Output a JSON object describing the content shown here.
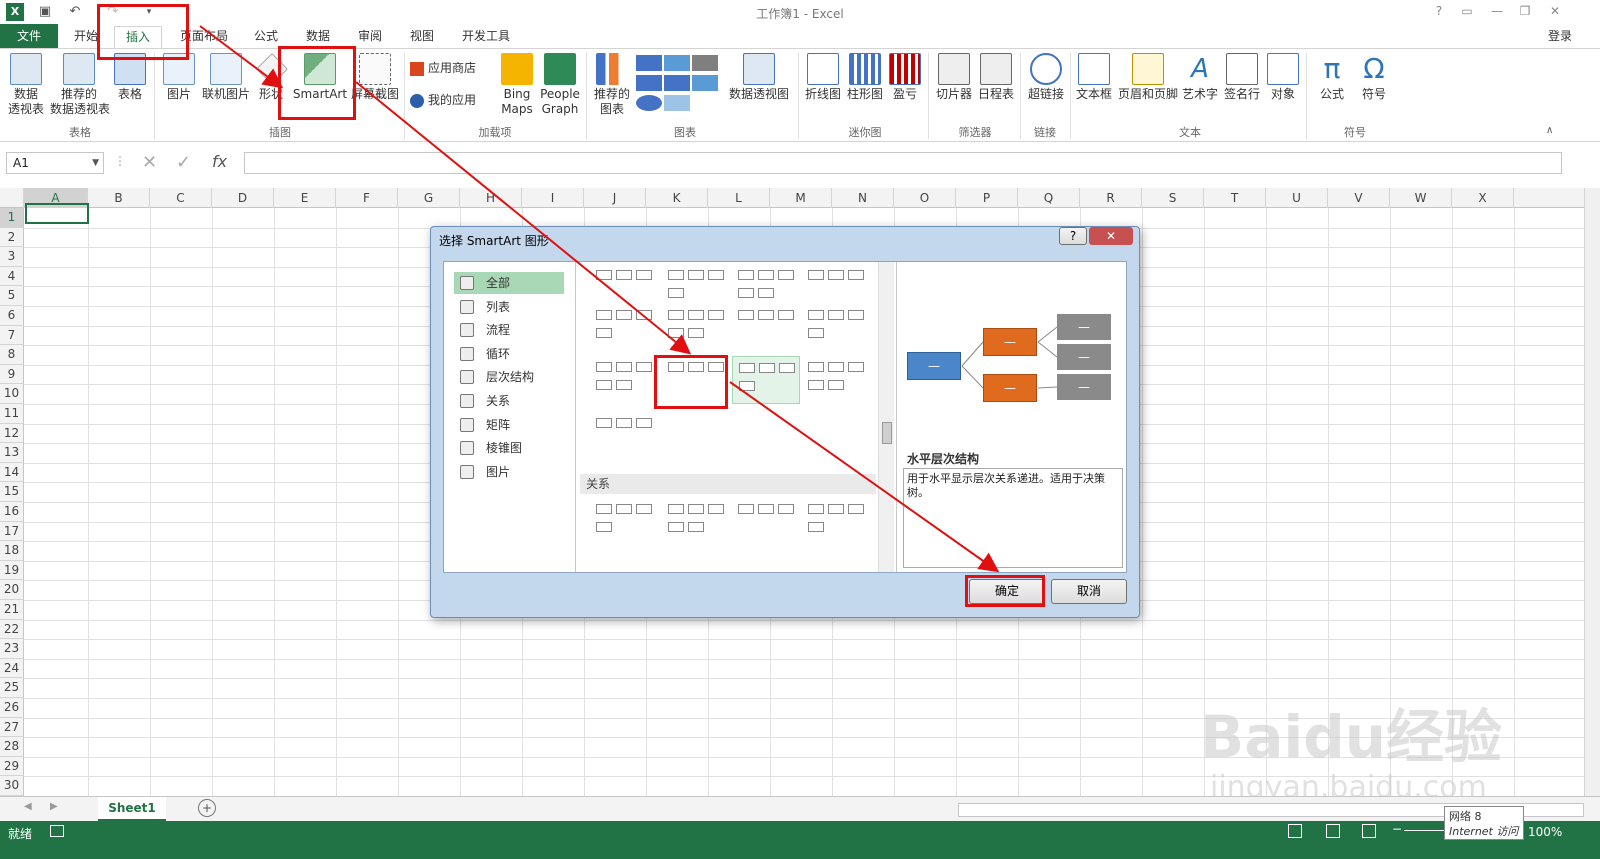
{
  "window": {
    "title": "工作簿1 - Excel",
    "login": "登录",
    "help_icon": "?"
  },
  "tabs": [
    "文件",
    "开始",
    "插入",
    "页面布局",
    "公式",
    "数据",
    "审阅",
    "视图",
    "开发工具"
  ],
  "ribbon": {
    "tables": {
      "pivot": "数据\n透视表",
      "recommended_pivot": "推荐的\n数据透视表",
      "table": "表格",
      "group": "表格"
    },
    "illustrations": {
      "pictures": "图片",
      "online_pictures": "联机图片",
      "shapes": "形状",
      "smartart": "SmartArt",
      "screenshot": "屏幕截图",
      "group": "插图"
    },
    "addins": {
      "store": "应用商店",
      "my_apps": "我的应用",
      "bing_maps": "Bing\nMaps",
      "people_graph": "People\nGraph",
      "group": "加载项"
    },
    "charts": {
      "recommended": "推荐的\n图表",
      "pivot_chart": "数据透视图",
      "group": "图表"
    },
    "sparklines": {
      "line": "折线图",
      "column": "柱形图",
      "winloss": "盈亏",
      "group": "迷你图"
    },
    "filters": {
      "slicer": "切片器",
      "timeline": "日程表",
      "group": "筛选器"
    },
    "links": {
      "hyperlink": "超链接",
      "group": "链接"
    },
    "text": {
      "textbox": "文本框",
      "header_footer": "页眉和页脚",
      "wordart": "艺术字",
      "signature": "签名行",
      "object": "对象",
      "group": "文本"
    },
    "symbols": {
      "equation": "公式",
      "symbol": "符号",
      "group": "符号"
    }
  },
  "formula_bar": {
    "name_box": "A1",
    "fx": "fx",
    "value": ""
  },
  "columns": [
    "A",
    "B",
    "C",
    "D",
    "E",
    "F",
    "G",
    "H",
    "I",
    "J",
    "K",
    "L",
    "M",
    "N",
    "O",
    "P",
    "Q",
    "R",
    "S",
    "T",
    "U",
    "V",
    "W",
    "X"
  ],
  "rows": [
    "1",
    "2",
    "3",
    "4",
    "5",
    "6",
    "7",
    "8",
    "9",
    "10",
    "11",
    "12",
    "13",
    "14",
    "15",
    "16",
    "17",
    "18",
    "19",
    "20",
    "21",
    "22",
    "23",
    "24",
    "25",
    "26",
    "27",
    "28",
    "29",
    "30"
  ],
  "dialog": {
    "title": "选择 SmartArt 图形",
    "categories": [
      "全部",
      "列表",
      "流程",
      "循环",
      "层次结构",
      "关系",
      "矩阵",
      "棱锥图",
      "图片"
    ],
    "section_label": "关系",
    "preview_title": "水平层次结构",
    "preview_desc": "用于水平显示层次关系递进。适用于决策树。",
    "ok": "确定",
    "cancel": "取消",
    "help": "?"
  },
  "sheet": {
    "tab": "Sheet1"
  },
  "status": {
    "ready": "就绪",
    "zoom": "100%"
  },
  "tooltip": {
    "line1": "网络 8",
    "line2": "Internet 访问"
  },
  "watermark": {
    "brand": "Baidu经验",
    "url": "jingyan.baidu.com"
  },
  "colors": {
    "excel_green": "#217346",
    "highlight_red": "#e01010",
    "preview_blue": "#4a86c8",
    "preview_orange": "#e06b1f",
    "preview_gray": "#8a8a8a"
  }
}
